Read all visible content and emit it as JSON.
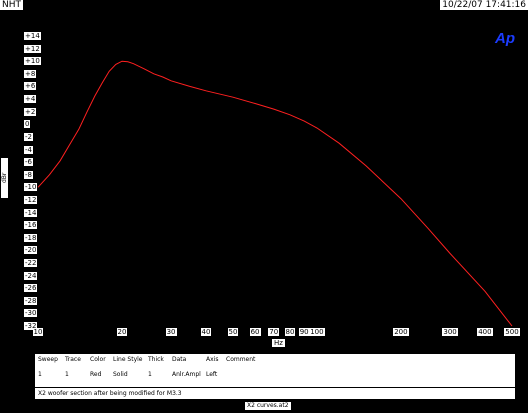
{
  "header": {
    "left_label": "NHT",
    "right_label": "10/22/07 17:41:16"
  },
  "logo_text": "Ap",
  "chart_data": {
    "type": "line",
    "title": "",
    "xlabel": "Hz",
    "ylabel": "dBr",
    "x_scale": "log",
    "xlim": [
      10,
      500
    ],
    "ylim": [
      -32,
      14
    ],
    "y_ticks": [
      "+14",
      "+12",
      "+10",
      "+8",
      "+6",
      "+4",
      "+2",
      "0",
      "-2",
      "-4",
      "-6",
      "-8",
      "-10",
      "-12",
      "-14",
      "-16",
      "-18",
      "-20",
      "-22",
      "-24",
      "-26",
      "-28",
      "-30",
      "-32"
    ],
    "x_ticks": [
      {
        "value": 10,
        "label": "10"
      },
      {
        "value": 20,
        "label": "20"
      },
      {
        "value": 30,
        "label": "30"
      },
      {
        "value": 40,
        "label": "40"
      },
      {
        "value": 50,
        "label": "50"
      },
      {
        "value": 60,
        "label": "60"
      },
      {
        "value": 70,
        "label": "70"
      },
      {
        "value": 80,
        "label": "80"
      },
      {
        "value": 90,
        "label": "90"
      },
      {
        "value": 100,
        "label": "100"
      },
      {
        "value": 200,
        "label": "200"
      },
      {
        "value": 300,
        "label": "300"
      },
      {
        "value": 400,
        "label": "400"
      },
      {
        "value": 500,
        "label": "500"
      }
    ],
    "grid": false,
    "series": [
      {
        "color": "#ff2020",
        "x": [
          10,
          11,
          12,
          13,
          14,
          15,
          16,
          17,
          18,
          19,
          20,
          21,
          22,
          24,
          26,
          28,
          30,
          35,
          40,
          50,
          60,
          70,
          80,
          90,
          100,
          120,
          150,
          200,
          250,
          300,
          400,
          500
        ],
        "y": [
          -10,
          -8,
          -5.8,
          -3.2,
          -0.8,
          2,
          4.5,
          6.6,
          8.4,
          9.5,
          10,
          9.9,
          9.6,
          8.8,
          8,
          7.5,
          6.9,
          6,
          5.3,
          4.3,
          3.3,
          2.4,
          1.5,
          0.5,
          -0.6,
          -3,
          -6.6,
          -11.8,
          -16.5,
          -20.5,
          -26.5,
          -32
        ]
      }
    ]
  },
  "legend": {
    "headers": {
      "sweep": "Sweep",
      "trace": "Trace",
      "color": "Color",
      "line_style": "Line Style",
      "thick": "Thick",
      "data": "Data",
      "axis": "Axis",
      "comment": "Comment"
    },
    "row": {
      "sweep": "1",
      "trace": "1",
      "color": "Red",
      "line_style": "Solid",
      "thick": "1",
      "data": "Anlr.Ampl",
      "axis": "Left",
      "comment": ""
    },
    "comment_text": "X2 woofer section after being modified for M3.3"
  },
  "footer_label": "X2 curves.at2"
}
